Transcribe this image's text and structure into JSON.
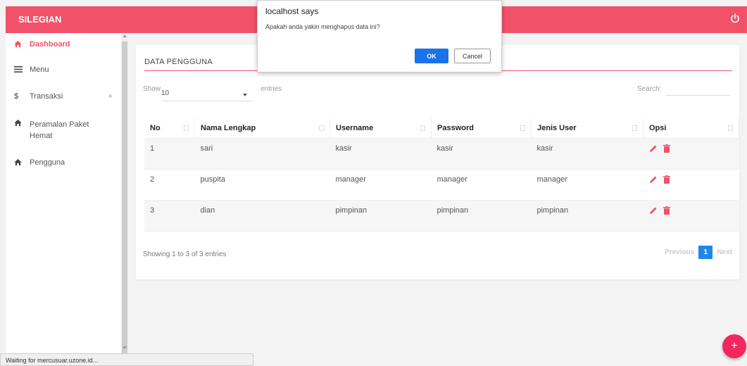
{
  "header": {
    "brand": "SILEGIAN",
    "power_icon": "power-icon"
  },
  "sidebar": {
    "items": [
      {
        "label": "Dashboard",
        "icon": "home-icon",
        "active": true
      },
      {
        "label": "Menu",
        "icon": "menu-icon"
      },
      {
        "label": "Transaksi",
        "icon": "dollar-icon",
        "expand": "+"
      },
      {
        "label": "Peramalan Paket Hemat",
        "icon": "home-icon"
      },
      {
        "label": "Pengguna",
        "icon": "home-icon"
      }
    ]
  },
  "card": {
    "title": "DATA PENGGUNA",
    "show_label": "Show",
    "show_value": "10",
    "entries_label": "entries",
    "search_label": "Search:",
    "search_value": ""
  },
  "table": {
    "headers": [
      "No",
      "Nama Lengkap",
      "Username",
      "Password",
      "Jenis User",
      "Opsi"
    ],
    "rows": [
      {
        "no": "1",
        "nama": "sari",
        "username": "kasir",
        "password": "kasir",
        "jenis": "kasir"
      },
      {
        "no": "2",
        "nama": "puspita",
        "username": "manager",
        "password": "manager",
        "jenis": "manager"
      },
      {
        "no": "3",
        "nama": "dian",
        "username": "pimpinan",
        "password": "pimpinan",
        "jenis": "pimpinan"
      }
    ]
  },
  "footer": {
    "showing": "Showing 1 to 3 of 3 entries",
    "previous": "Previous",
    "current_page": "1",
    "next": "Next"
  },
  "dialog": {
    "title": "localhost says",
    "message": "Apakah anda yakin menghapus data ini?",
    "ok": "OK",
    "cancel": "Cancel"
  },
  "fab": {
    "label": "+"
  },
  "status": "Waiting for mercusuar.uzone.id...",
  "colors": {
    "accent": "#f2516a",
    "primary": "#1a73e8",
    "fab": "#f0285f"
  }
}
